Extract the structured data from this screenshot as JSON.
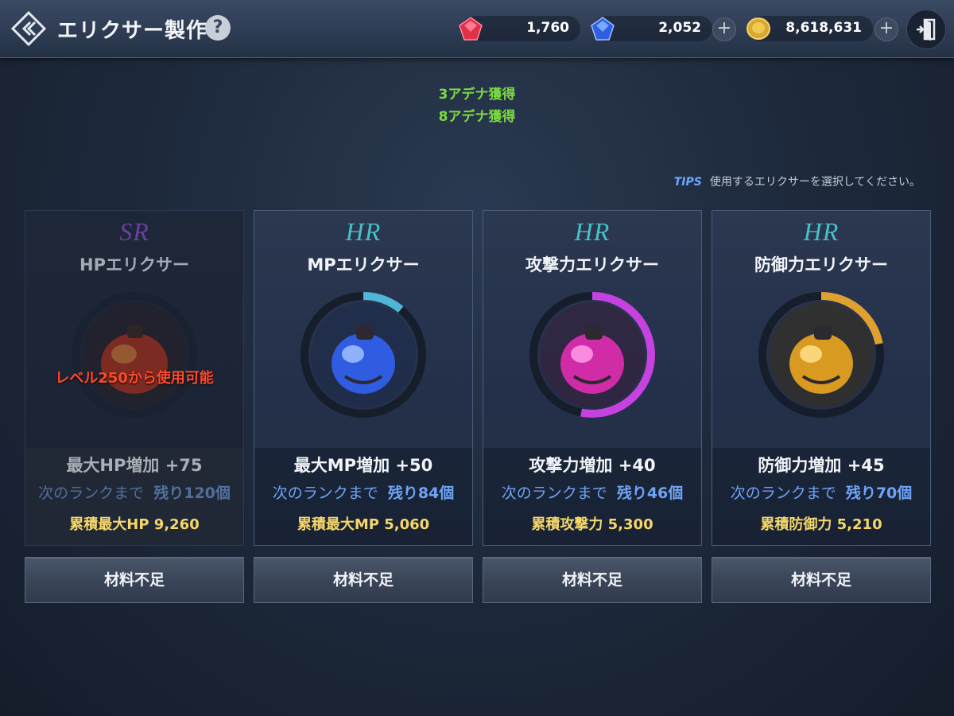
{
  "header": {
    "title": "エリクサー製作",
    "help_label": "?"
  },
  "currencies": [
    {
      "name": "red-gem",
      "value": "1,760"
    },
    {
      "name": "blue-gem",
      "value": "2,052"
    },
    {
      "name": "gold-coin",
      "value": "8,618,631"
    }
  ],
  "gains": [
    "3アデナ獲得",
    "8アデナ獲得"
  ],
  "tips": {
    "tag": "TIPS",
    "text": "使用するエリクサーを選択してください。"
  },
  "cards": [
    {
      "rarity": "SR",
      "rarity_color": "#6a3fa0",
      "name": "HPエリクサー",
      "lock_text": "レベル250から使用可能",
      "stat": "最大HP増加 +75",
      "rank_label": "次のランクまで",
      "rank_rest": "残り120個",
      "total": "累積最大HP 9,260",
      "button": "材料不足",
      "progress": 0,
      "color": "#e06a2a",
      "enabled": false
    },
    {
      "rarity": "HR",
      "rarity_color": "#47c0c8",
      "name": "MPエリクサー",
      "stat": "最大MP増加 +50",
      "rank_label": "次のランクまで",
      "rank_rest": "残り84個",
      "total": "累積最大MP 5,060",
      "button": "材料不足",
      "progress": 0.11,
      "color": "#3a6df0",
      "enabled": true
    },
    {
      "rarity": "HR",
      "rarity_color": "#47c0c8",
      "name": "攻撃力エリクサー",
      "stat": "攻撃力増加 +40",
      "rank_label": "次のランクまで",
      "rank_rest": "残り46個",
      "total": "累積攻撃力 5,300",
      "button": "材料不足",
      "progress": 0.53,
      "color": "#d838c8",
      "enabled": true
    },
    {
      "rarity": "HR",
      "rarity_color": "#47c0c8",
      "name": "防御力エリクサー",
      "stat": "防御力増加 +45",
      "rank_label": "次のランクまで",
      "rank_rest": "残り70個",
      "total": "累積防御力 5,210",
      "button": "材料不足",
      "progress": 0.22,
      "color": "#e0a030",
      "enabled": true
    }
  ],
  "colors": {
    "ring_progress_mp": "#4fb6d8",
    "ring_progress_atk": "#c542e0",
    "ring_progress_def": "#e0a030"
  }
}
